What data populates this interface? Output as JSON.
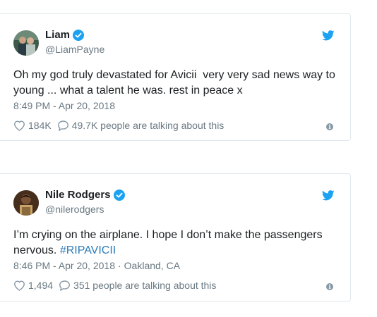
{
  "tweets": [
    {
      "name": "Liam",
      "handle": "@LiamPayne",
      "text": "Oh my god truly devastated for Avicii  very very sad news way to young ... what a talent he was. rest in peace x",
      "time": "8:49 PM - Apr 20, 2018",
      "location": "",
      "likes": "184K",
      "talking": "49.7K people are talking about this"
    },
    {
      "name": "Nile Rodgers",
      "handle": "@nilerodgers",
      "text_before": "I’m crying on the airplane. I hope I don’t make the passengers nervous. ",
      "hashtag": "#RIPAVICII",
      "time": "8:46 PM - Apr 20, 2018",
      "location_sep": "·",
      "location": "Oakland, CA",
      "likes": "1,494",
      "talking": "351 people are talking about this"
    }
  ],
  "colors": {
    "twitter_blue": "#1da1f2",
    "link_blue": "#2b7bb9",
    "muted_text": "#697882",
    "border": "#e1e8ed"
  },
  "icons": {
    "verified": "verified-badge-icon",
    "brand": "twitter-bird-icon",
    "like": "heart-icon",
    "reply": "speech-bubble-icon",
    "info": "info-icon"
  }
}
